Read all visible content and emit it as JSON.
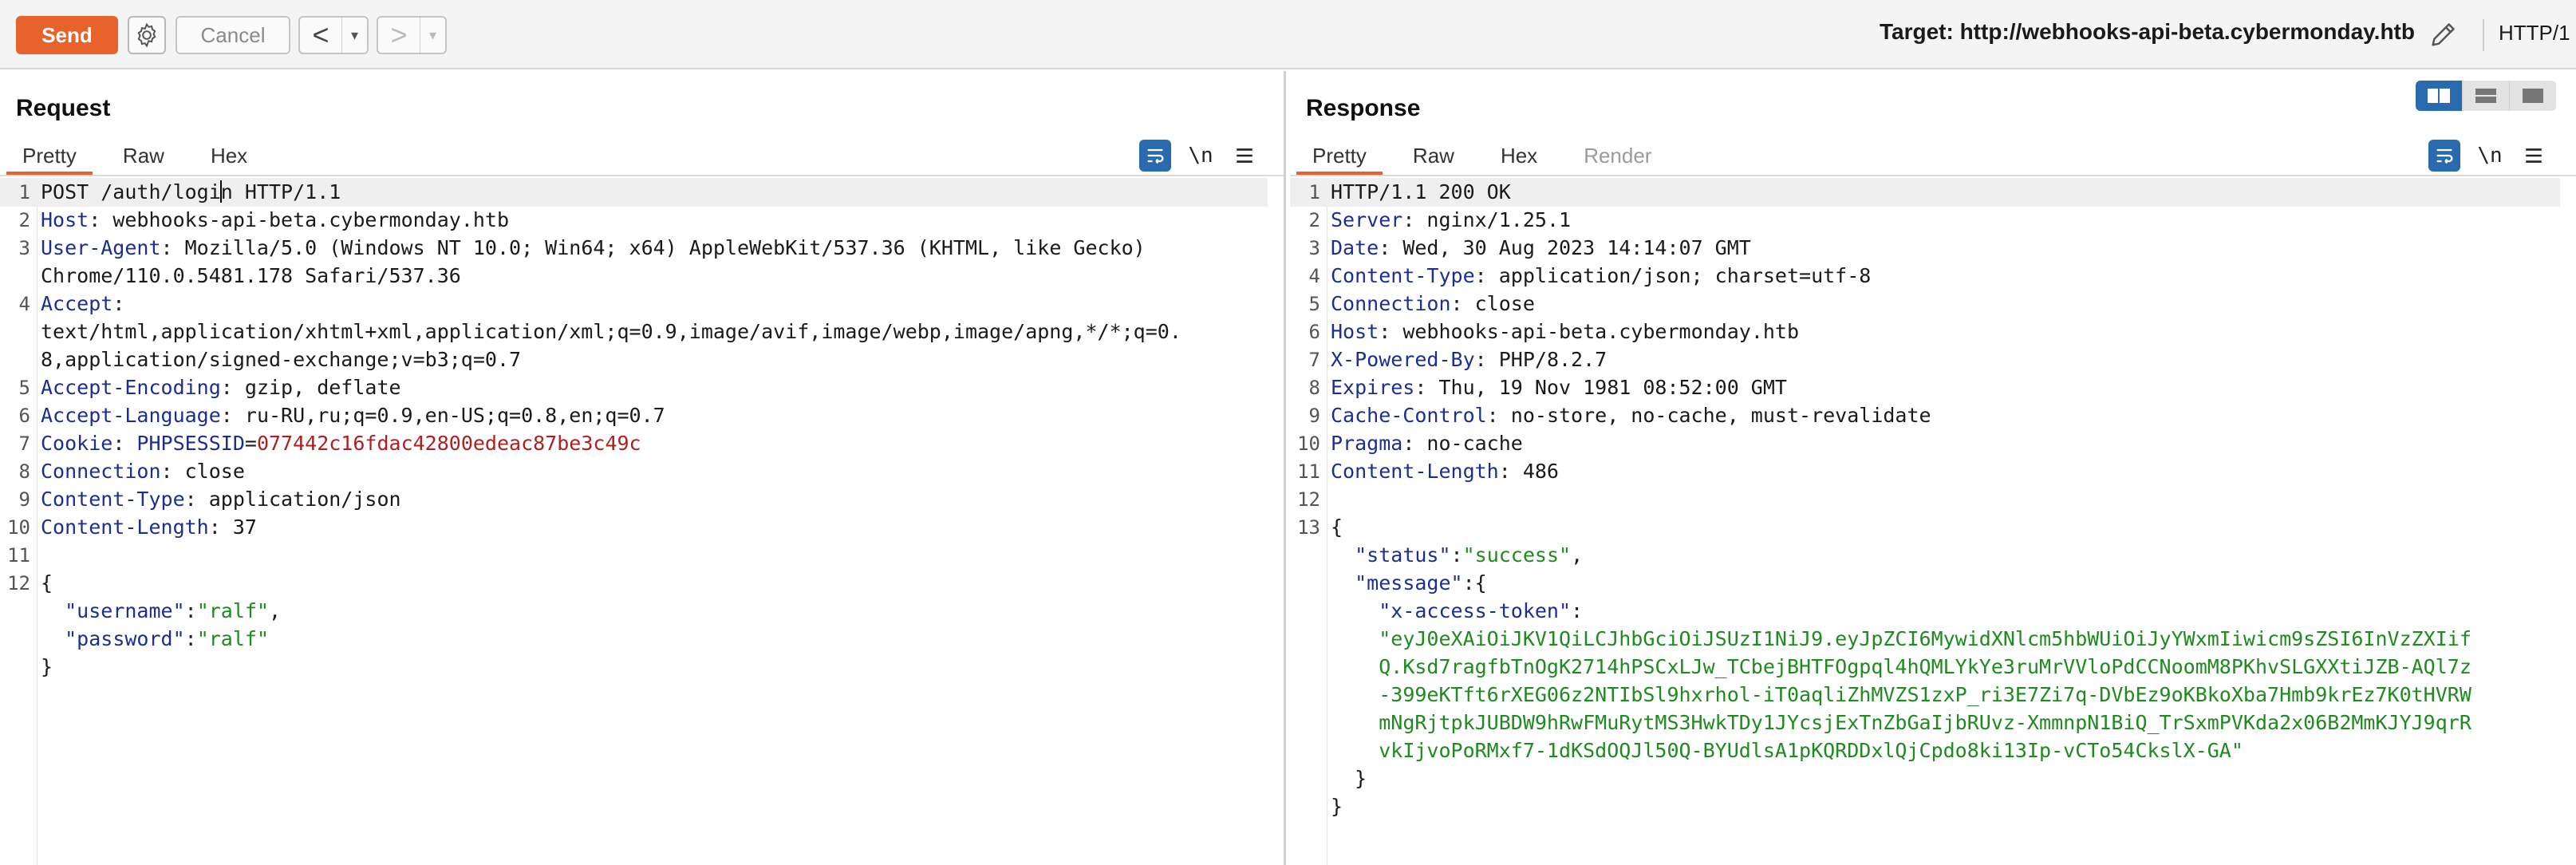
{
  "toolbar": {
    "send_label": "Send",
    "cancel_label": "Cancel",
    "back_arrow": "<",
    "forward_arrow": ">",
    "dropdown_glyph": "▾",
    "target": "Target: http://webhooks-api-beta.cybermonday.htb",
    "protocol": "HTTP/1"
  },
  "request": {
    "title": "Request",
    "tabs": [
      "Pretty",
      "Raw",
      "Hex"
    ],
    "active_tab": "Pretty",
    "newline_toggle": "\\n",
    "lines": [
      {
        "n": "1",
        "method_part": "POST /auth/logi",
        "rest": "n HTTP/1.1"
      },
      {
        "n": "2",
        "key": "Host",
        "value": " webhooks-api-beta.cybermonday.htb"
      },
      {
        "n": "3",
        "key": "User-Agent",
        "value": " Mozilla/5.0 (Windows NT 10.0; Win64; x64) AppleWebKit/537.36 (KHTML, like Gecko)"
      },
      {
        "n": "",
        "value": "Chrome/110.0.5481.178 Safari/537.36"
      },
      {
        "n": "4",
        "key": "Accept",
        "value": ""
      },
      {
        "n": "",
        "value": "text/html,application/xhtml+xml,application/xml;q=0.9,image/avif,image/webp,image/apng,*/*;q=0."
      },
      {
        "n": "",
        "value": "8,application/signed-exchange;v=b3;q=0.7"
      },
      {
        "n": "5",
        "key": "Accept-Encoding",
        "value": " gzip, deflate"
      },
      {
        "n": "6",
        "key": "Accept-Language",
        "value": " ru-RU,ru;q=0.9,en-US;q=0.8,en;q=0.7"
      },
      {
        "n": "7",
        "key": "Cookie",
        "cookie_name": "PHPSESSID",
        "cookie_value": "077442c16fdac42800edeac87be3c49c"
      },
      {
        "n": "8",
        "key": "Connection",
        "value": " close"
      },
      {
        "n": "9",
        "key": "Content-Type",
        "value": " application/json"
      },
      {
        "n": "10",
        "key": "Content-Length",
        "value": " 37"
      },
      {
        "n": "11",
        "value": ""
      },
      {
        "n": "12",
        "value": "{"
      },
      {
        "n": "",
        "indent": "  ",
        "jkey": "\"username\"",
        "jval": "\"ralf\"",
        "trail": ","
      },
      {
        "n": "",
        "indent": "  ",
        "jkey": "\"password\"",
        "jval": "\"ralf\"",
        "trail": ""
      },
      {
        "n": "",
        "value": "}"
      }
    ]
  },
  "response": {
    "title": "Response",
    "tabs": [
      "Pretty",
      "Raw",
      "Hex",
      "Render"
    ],
    "active_tab": "Pretty",
    "newline_toggle": "\\n",
    "lines": [
      {
        "n": "1",
        "value": "HTTP/1.1 200 OK"
      },
      {
        "n": "2",
        "key": "Server",
        "value": " nginx/1.25.1"
      },
      {
        "n": "3",
        "key": "Date",
        "value": " Wed, 30 Aug 2023 14:14:07 GMT"
      },
      {
        "n": "4",
        "key": "Content-Type",
        "value": " application/json; charset=utf-8"
      },
      {
        "n": "5",
        "key": "Connection",
        "value": " close"
      },
      {
        "n": "6",
        "key": "Host",
        "value": " webhooks-api-beta.cybermonday.htb"
      },
      {
        "n": "7",
        "key": "X-Powered-By",
        "value": " PHP/8.2.7"
      },
      {
        "n": "8",
        "key": "Expires",
        "value": " Thu, 19 Nov 1981 08:52:00 GMT"
      },
      {
        "n": "9",
        "key": "Cache-Control",
        "value": " no-store, no-cache, must-revalidate"
      },
      {
        "n": "10",
        "key": "Pragma",
        "value": " no-cache"
      },
      {
        "n": "11",
        "key": "Content-Length",
        "value": " 486"
      },
      {
        "n": "12",
        "value": ""
      },
      {
        "n": "13",
        "value": "{"
      },
      {
        "n": "",
        "indent": "  ",
        "jkey": "\"status\"",
        "jval": "\"success\"",
        "trail": ","
      },
      {
        "n": "",
        "indent": "  ",
        "jkey": "\"message\"",
        "jval": "",
        "trail": "{"
      },
      {
        "n": "",
        "indent": "    ",
        "jkey": "\"x-access-token\"",
        "jval": "",
        "trail": ""
      },
      {
        "n": "",
        "indent": "    ",
        "jstr": "\"eyJ0eXAiOiJKV1QiLCJhbGciOiJSUzI1NiJ9.eyJpZCI6MywidXNlcm5hbWUiOiJyYWxmIiwicm9sZSI6InVzZXIif"
      },
      {
        "n": "",
        "indent": "    ",
        "jstr": "Q.Ksd7ragfbTnOgK2714hPSCxLJw_TCbejBHTFOgpql4hQMLYkYe3ruMrVVloPdCCNoomM8PKhvSLGXXtiJZB-AQl7z"
      },
      {
        "n": "",
        "indent": "    ",
        "jstr": "-399eKTft6rXEG06z2NTIbSl9hxrhol-iT0aqliZhMVZS1zxP_ri3E7Zi7q-DVbEz9oKBkoXba7Hmb9krEz7K0tHVRW"
      },
      {
        "n": "",
        "indent": "    ",
        "jstr": "mNgRjtpkJUBDW9hRwFMuRytMS3HwkTDy1JYcsjExTnZbGaIjbRUvz-XmmnpN1BiQ_TrSxmPVKda2x06B2MmKJYJ9qrR"
      },
      {
        "n": "",
        "indent": "    ",
        "jstr": "vkIjvoPoRMxf7-1dKSdOQJl50Q-BYUdlsA1pKQRDDxlQjCpdo8ki13Ip-vCTo54CkslX-GA\""
      },
      {
        "n": "",
        "indent": "  ",
        "value": "}"
      },
      {
        "n": "",
        "value": "}"
      }
    ]
  },
  "colors": {
    "send": "#e8622c",
    "active_tab_underline": "#e8622c",
    "header_key": "#1c2f8f",
    "cookie_value": "#b01f1f",
    "json_string": "#1f8a1f",
    "toggle_active": "#2a6bb0"
  },
  "icons": [
    "gear-icon",
    "pencil-icon",
    "wrap-lines-icon",
    "menu-icon",
    "layout-side-by-side-icon",
    "layout-stacked-icon",
    "layout-single-icon"
  ]
}
